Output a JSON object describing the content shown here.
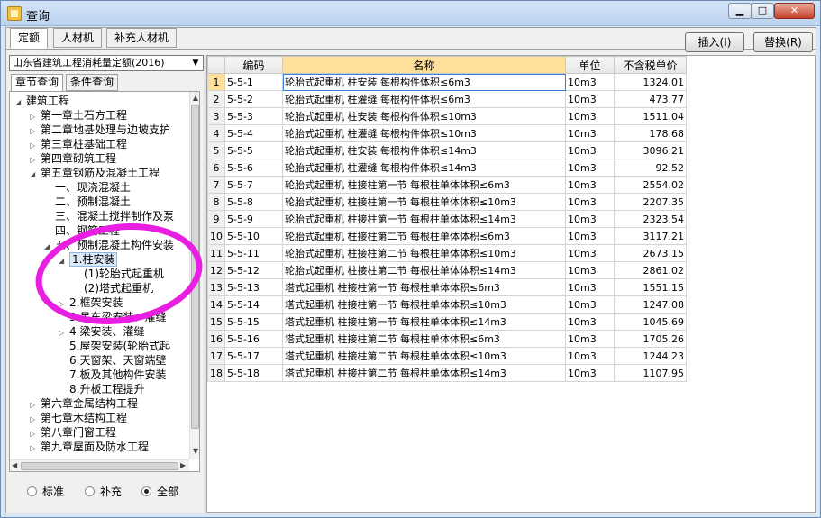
{
  "window": {
    "title": "查询"
  },
  "tabs": [
    "定额",
    "人材机",
    "补充人材机"
  ],
  "buttons": {
    "insert": "插入(I)",
    "replace": "替换(R)"
  },
  "quota_set": {
    "selected": "山东省建筑工程消耗量定额(2016)"
  },
  "sub_tabs": [
    "章节查询",
    "条件查询"
  ],
  "tree": [
    {
      "label": "建筑工程",
      "level": 0,
      "exp": "open"
    },
    {
      "label": "第一章土石方工程",
      "level": 1,
      "exp": "closed"
    },
    {
      "label": "第二章地基处理与边坡支护",
      "level": 1,
      "exp": "closed"
    },
    {
      "label": "第三章桩基础工程",
      "level": 1,
      "exp": "closed"
    },
    {
      "label": "第四章砌筑工程",
      "level": 1,
      "exp": "closed"
    },
    {
      "label": "第五章钢筋及混凝土工程",
      "level": 1,
      "exp": "open"
    },
    {
      "label": "一、现浇混凝土",
      "level": 2,
      "exp": ""
    },
    {
      "label": "二、预制混凝土",
      "level": 2,
      "exp": ""
    },
    {
      "label": "三、混凝土搅拌制作及泵",
      "level": 2,
      "exp": ""
    },
    {
      "label": "四、钢筋工程",
      "level": 2,
      "exp": ""
    },
    {
      "label": "五、预制混凝土构件安装",
      "level": 2,
      "exp": "open"
    },
    {
      "label": "1.柱安装",
      "level": 3,
      "exp": "open",
      "selected": true
    },
    {
      "label": "(1)轮胎式起重机",
      "level": 4,
      "exp": ""
    },
    {
      "label": "(2)塔式起重机",
      "level": 4,
      "exp": ""
    },
    {
      "label": "2.框架安装",
      "level": 3,
      "exp": "closed"
    },
    {
      "label": "3.吊车梁安装、灌缝",
      "level": 3,
      "exp": ""
    },
    {
      "label": "4.梁安装、灌缝",
      "level": 3,
      "exp": "closed"
    },
    {
      "label": "5.屋架安装(轮胎式起",
      "level": 3,
      "exp": ""
    },
    {
      "label": "6.天窗架、天窗端壁",
      "level": 3,
      "exp": ""
    },
    {
      "label": "7.板及其他构件安装",
      "level": 3,
      "exp": ""
    },
    {
      "label": "8.升板工程提升",
      "level": 3,
      "exp": ""
    },
    {
      "label": "第六章金属结构工程",
      "level": 1,
      "exp": "closed"
    },
    {
      "label": "第七章木结构工程",
      "level": 1,
      "exp": "closed"
    },
    {
      "label": "第八章门窗工程",
      "level": 1,
      "exp": "closed"
    },
    {
      "label": "第九章屋面及防水工程",
      "level": 1,
      "exp": "closed"
    }
  ],
  "filters": [
    {
      "label": "标准",
      "checked": false
    },
    {
      "label": "补充",
      "checked": false
    },
    {
      "label": "全部",
      "checked": true
    }
  ],
  "table": {
    "columns": [
      "编码",
      "名称",
      "单位",
      "不含税单价"
    ],
    "rows": [
      [
        "5-5-1",
        "轮胎式起重机 柱安装 每根构件体积≤6m3",
        "10m3",
        "1324.01"
      ],
      [
        "5-5-2",
        "轮胎式起重机 柱灌缝 每根构件体积≤6m3",
        "10m3",
        "473.77"
      ],
      [
        "5-5-3",
        "轮胎式起重机 柱安装 每根构件体积≤10m3",
        "10m3",
        "1511.04"
      ],
      [
        "5-5-4",
        "轮胎式起重机 柱灌缝 每根构件体积≤10m3",
        "10m3",
        "178.68"
      ],
      [
        "5-5-5",
        "轮胎式起重机 柱安装 每根构件体积≤14m3",
        "10m3",
        "3096.21"
      ],
      [
        "5-5-6",
        "轮胎式起重机 柱灌缝 每根构件体积≤14m3",
        "10m3",
        "92.52"
      ],
      [
        "5-5-7",
        "轮胎式起重机 柱接柱第一节 每根柱单体体积≤6m3",
        "10m3",
        "2554.02"
      ],
      [
        "5-5-8",
        "轮胎式起重机 柱接柱第一节 每根柱单体体积≤10m3",
        "10m3",
        "2207.35"
      ],
      [
        "5-5-9",
        "轮胎式起重机 柱接柱第一节 每根柱单体体积≤14m3",
        "10m3",
        "2323.54"
      ],
      [
        "5-5-10",
        "轮胎式起重机 柱接柱第二节 每根柱单体体积≤6m3",
        "10m3",
        "3117.21"
      ],
      [
        "5-5-11",
        "轮胎式起重机 柱接柱第二节 每根柱单体体积≤10m3",
        "10m3",
        "2673.15"
      ],
      [
        "5-5-12",
        "轮胎式起重机 柱接柱第二节 每根柱单体体积≤14m3",
        "10m3",
        "2861.02"
      ],
      [
        "5-5-13",
        "塔式起重机 柱接柱第一节 每根柱单体体积≤6m3",
        "10m3",
        "1551.15"
      ],
      [
        "5-5-14",
        "塔式起重机 柱接柱第一节 每根柱单体体积≤10m3",
        "10m3",
        "1247.08"
      ],
      [
        "5-5-15",
        "塔式起重机 柱接柱第一节 每根柱单体体积≤14m3",
        "10m3",
        "1045.69"
      ],
      [
        "5-5-16",
        "塔式起重机 柱接柱第二节 每根柱单体体积≤6m3",
        "10m3",
        "1705.26"
      ],
      [
        "5-5-17",
        "塔式起重机 柱接柱第二节 每根柱单体体积≤10m3",
        "10m3",
        "1244.23"
      ],
      [
        "5-5-18",
        "塔式起重机 柱接柱第二节 每根柱单体体积≤14m3",
        "10m3",
        "1107.95"
      ]
    ]
  },
  "colors": {
    "header_highlight": "#ffe09a",
    "annotation": "#e81ee0",
    "selection": "#3c7fd6"
  }
}
